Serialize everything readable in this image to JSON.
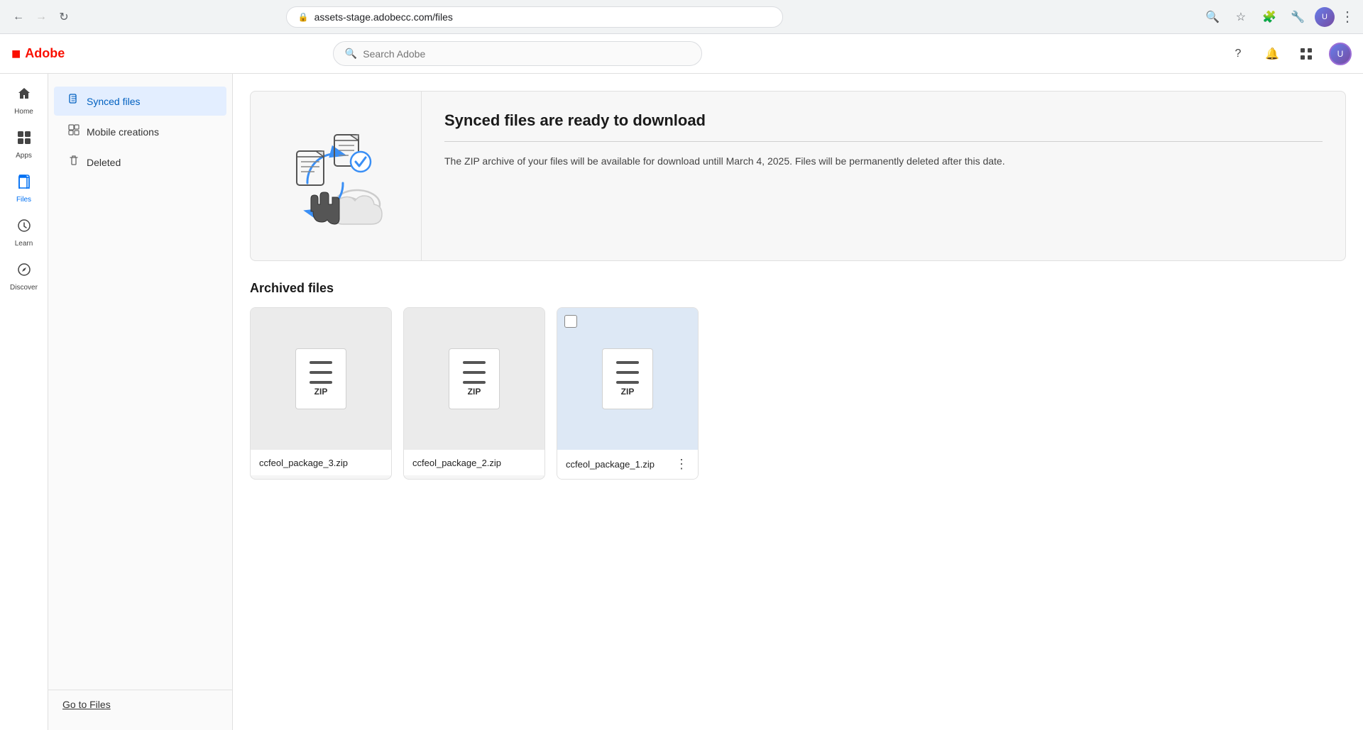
{
  "browser": {
    "url": "assets-stage.adobecc.com/files",
    "back_disabled": false,
    "forward_disabled": true
  },
  "top_nav": {
    "logo_icon": "A",
    "logo_text": "Adobe",
    "search_placeholder": "Search Adobe",
    "help_icon": "?",
    "bell_icon": "🔔",
    "grid_icon": "⋮⋮"
  },
  "left_sidebar": {
    "items": [
      {
        "id": "home",
        "label": "Home",
        "icon": "⌂",
        "active": false
      },
      {
        "id": "apps",
        "label": "Apps",
        "icon": "⊞",
        "active": false
      },
      {
        "id": "files",
        "label": "Files",
        "icon": "📄",
        "active": true
      },
      {
        "id": "learn",
        "label": "Learn",
        "icon": "💡",
        "active": false
      },
      {
        "id": "discover",
        "label": "Discover",
        "icon": "🔍",
        "active": false
      }
    ]
  },
  "content_sidebar": {
    "nav_items": [
      {
        "id": "synced-files",
        "label": "Synced files",
        "icon": "📋",
        "active": true
      },
      {
        "id": "mobile-creations",
        "label": "Mobile creations",
        "icon": "🗂",
        "active": false
      },
      {
        "id": "deleted",
        "label": "Deleted",
        "icon": "🗑",
        "active": false
      }
    ],
    "go_to_files_label": "Go to Files"
  },
  "banner": {
    "title": "Synced files are ready to download",
    "description": "The ZIP archive of your files will be available for download untill March 4, 2025. Files will be permanently deleted after this date."
  },
  "archived_files": {
    "section_title": "Archived files",
    "files": [
      {
        "id": 1,
        "name": "ccfeol_package_3.zip",
        "selected": false,
        "show_checkbox": false,
        "show_more": false
      },
      {
        "id": 2,
        "name": "ccfeol_package_2.zip",
        "selected": false,
        "show_checkbox": false,
        "show_more": false
      },
      {
        "id": 3,
        "name": "ccfeol_package_1.zip",
        "selected": false,
        "show_checkbox": true,
        "show_more": true
      }
    ]
  }
}
